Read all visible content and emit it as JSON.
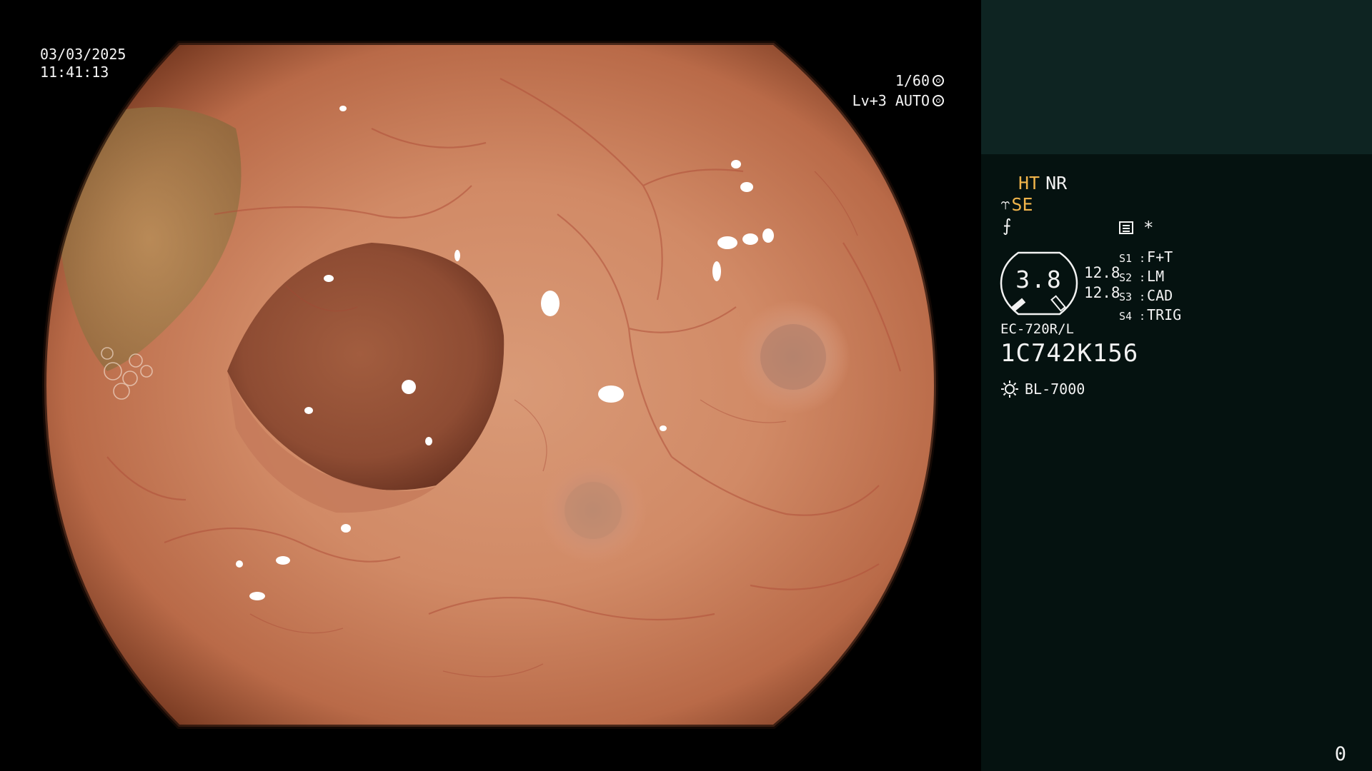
{
  "overlay": {
    "date": "03/03/2025",
    "time": "11:41:13",
    "shutter": "1/60",
    "level": "Lv+3 AUTO"
  },
  "panel": {
    "ht": "HT",
    "nr": "NR",
    "se": "SE",
    "gauge_value": "3.8",
    "gauge_r1": "12.8",
    "gauge_r2": "12.8",
    "scope_switches": [
      {
        "key": "S1",
        "value": "F+T"
      },
      {
        "key": "S2",
        "value": "LM"
      },
      {
        "key": "S3",
        "value": "CAD"
      },
      {
        "key": "S4",
        "value": "TRIG"
      }
    ],
    "scope_model": "EC-720R/L",
    "serial": "1C742K156",
    "light_source": "BL-7000",
    "page_counter": "0"
  },
  "colors": {
    "panel_bg": "#051210",
    "panel_top_bg": "#0e2422",
    "accent_orange": "#f0b44b"
  },
  "icons": [
    "shutter-icon",
    "auto-iris-icon",
    "se-mode-icon",
    "enhance-f-icon",
    "menu-icon",
    "star-icon",
    "gauge-icon",
    "light-source-icon"
  ]
}
